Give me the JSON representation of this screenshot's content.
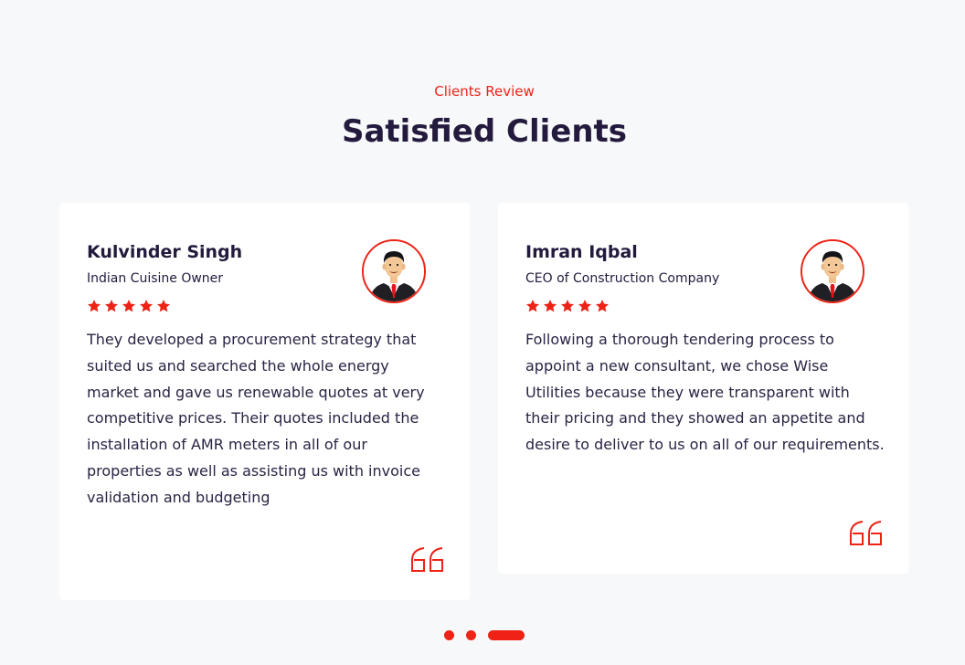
{
  "section": {
    "eyebrow": "Clients Review",
    "title": "Satisfied Clients"
  },
  "colors": {
    "accent": "#ee2316",
    "heading": "#231a3d",
    "background": "#f7f8fa",
    "card": "#ffffff"
  },
  "testimonials": [
    {
      "name": "Kulvinder Singh",
      "role": "Indian Cuisine Owner",
      "rating": 5,
      "review": "They developed a procurement strategy that suited us and searched the whole energy market and gave us renewable quotes at very competitive prices. Their quotes included the installation of AMR meters in all of our properties as well as assisting us with invoice validation and budgeting",
      "avatar_icon": "businessman-avatar",
      "quote_icon": "quote-icon"
    },
    {
      "name": "Imran Iqbal",
      "role": "CEO of Construction Company",
      "rating": 5,
      "review": "Following a thorough tendering process to appoint a new consultant, we chose Wise Utilities because they were transparent with their pricing and they showed an appetite and desire to deliver to us on all of our requirements.",
      "avatar_icon": "businessman-avatar",
      "quote_icon": "quote-icon"
    }
  ],
  "pagination": {
    "pages": 3,
    "active_index": 2
  }
}
